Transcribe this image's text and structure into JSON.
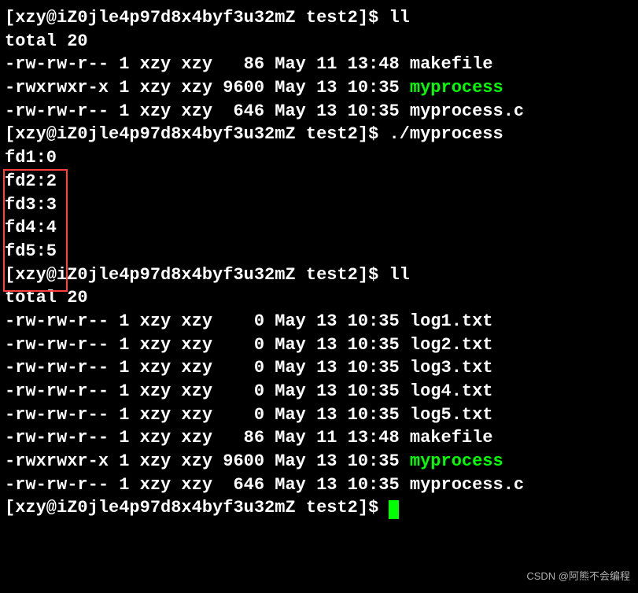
{
  "prompt": {
    "full": "[xzy@iZ0jle4p97d8x4byf3u32mZ test2]$ "
  },
  "cmd1": "ll",
  "total1": "total 20",
  "ls1": [
    {
      "perm": "-rw-rw-r--",
      "links": "1",
      "user": "xzy",
      "group": "xzy",
      "size": "  86",
      "date": "May 11 13:48",
      "name": "makefile",
      "exec": false
    },
    {
      "perm": "-rwxrwxr-x",
      "links": "1",
      "user": "xzy",
      "group": "xzy",
      "size": "9600",
      "date": "May 13 10:35",
      "name": "myprocess",
      "exec": true
    },
    {
      "perm": "-rw-rw-r--",
      "links": "1",
      "user": "xzy",
      "group": "xzy",
      "size": " 646",
      "date": "May 13 10:35",
      "name": "myprocess.c",
      "exec": false
    }
  ],
  "cmd2": "./myprocess",
  "fd_output": [
    "fd1:0",
    "fd2:2",
    "fd3:3",
    "fd4:4",
    "fd5:5"
  ],
  "cmd3": "ll",
  "total2": "total 20",
  "ls2": [
    {
      "perm": "-rw-rw-r--",
      "links": "1",
      "user": "xzy",
      "group": "xzy",
      "size": "   0",
      "date": "May 13 10:35",
      "name": "log1.txt",
      "exec": false
    },
    {
      "perm": "-rw-rw-r--",
      "links": "1",
      "user": "xzy",
      "group": "xzy",
      "size": "   0",
      "date": "May 13 10:35",
      "name": "log2.txt",
      "exec": false
    },
    {
      "perm": "-rw-rw-r--",
      "links": "1",
      "user": "xzy",
      "group": "xzy",
      "size": "   0",
      "date": "May 13 10:35",
      "name": "log3.txt",
      "exec": false
    },
    {
      "perm": "-rw-rw-r--",
      "links": "1",
      "user": "xzy",
      "group": "xzy",
      "size": "   0",
      "date": "May 13 10:35",
      "name": "log4.txt",
      "exec": false
    },
    {
      "perm": "-rw-rw-r--",
      "links": "1",
      "user": "xzy",
      "group": "xzy",
      "size": "   0",
      "date": "May 13 10:35",
      "name": "log5.txt",
      "exec": false
    },
    {
      "perm": "-rw-rw-r--",
      "links": "1",
      "user": "xzy",
      "group": "xzy",
      "size": "  86",
      "date": "May 11 13:48",
      "name": "makefile",
      "exec": false
    },
    {
      "perm": "-rwxrwxr-x",
      "links": "1",
      "user": "xzy",
      "group": "xzy",
      "size": "9600",
      "date": "May 13 10:35",
      "name": "myprocess",
      "exec": true
    },
    {
      "perm": "-rw-rw-r--",
      "links": "1",
      "user": "xzy",
      "group": "xzy",
      "size": " 646",
      "date": "May 13 10:35",
      "name": "myprocess.c",
      "exec": false
    }
  ],
  "watermark": "CSDN @阿熊不会编程"
}
